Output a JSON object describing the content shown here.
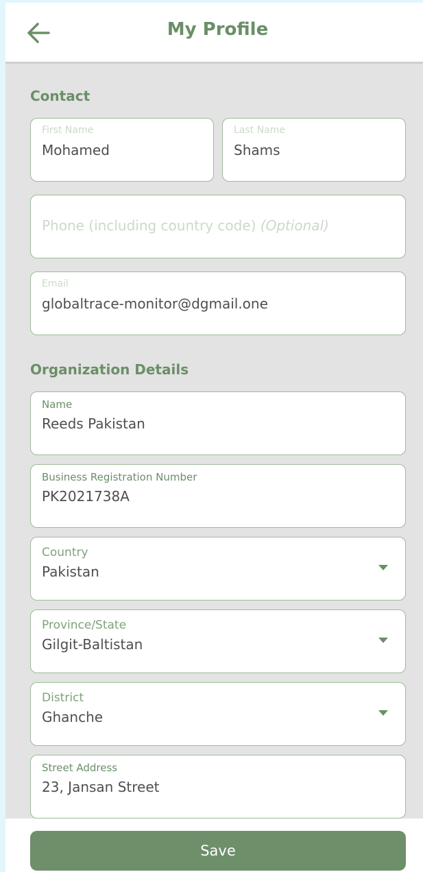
{
  "header": {
    "title": "My Profile",
    "back_icon": "arrow-left-icon"
  },
  "contact": {
    "section_title": "Contact",
    "first_name": {
      "label": "First Name",
      "value": "Mohamed"
    },
    "last_name": {
      "label": "Last Name",
      "value": "Shams"
    },
    "phone": {
      "placeholder": "Phone (including country code)",
      "optional": "(Optional)"
    },
    "email": {
      "label": "Email",
      "value": "globaltrace-monitor@dgmail.one"
    }
  },
  "organization": {
    "section_title": "Organization Details",
    "name": {
      "label": "Name",
      "value": "Reeds Pakistan"
    },
    "registration": {
      "label": "Business Registration Number",
      "value": "PK2021738A"
    },
    "country": {
      "label": "Country",
      "value": "Pakistan"
    },
    "province": {
      "label": "Province/State",
      "value": "Gilgit-Baltistan"
    },
    "district": {
      "label": "District",
      "value": "Ghanche"
    },
    "street": {
      "label": "Street Address",
      "value": "23, Jansan Street"
    }
  },
  "footer": {
    "save_label": "Save"
  },
  "colors": {
    "accent": "#6a8f67",
    "button": "#6d8f6a",
    "border": "#9cbb97",
    "background": "#e3e3e3"
  }
}
